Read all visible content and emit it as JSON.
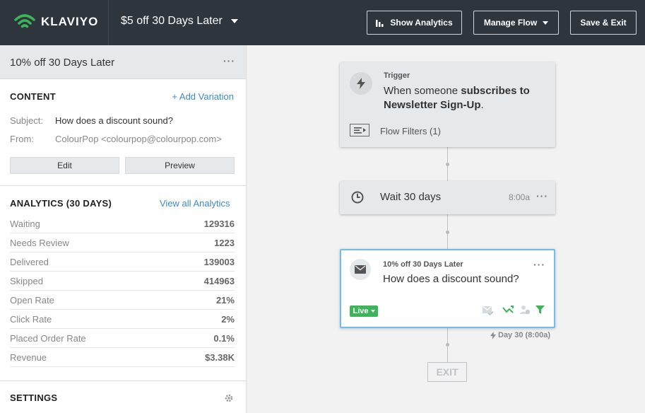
{
  "header": {
    "brand": "KLAVIYO",
    "flow_name": "$5 off 30 Days Later",
    "show_analytics": "Show Analytics",
    "manage_flow": "Manage Flow",
    "save_exit": "Save & Exit"
  },
  "sidebar": {
    "title": "10% off 30 Days Later",
    "more": "···",
    "content": {
      "heading": "CONTENT",
      "add_variation": "+ Add Variation",
      "subject_label": "Subject:",
      "subject_value": "How does a discount sound?",
      "from_label": "From:",
      "from_value": "ColourPop <colourpop@colourpop.com>",
      "edit": "Edit",
      "preview": "Preview"
    },
    "analytics": {
      "heading": "ANALYTICS (30 DAYS)",
      "view_all": "View all Analytics",
      "rows": [
        {
          "label": "Waiting",
          "value": "129316"
        },
        {
          "label": "Needs Review",
          "value": "1223"
        },
        {
          "label": "Delivered",
          "value": "139003"
        },
        {
          "label": "Skipped",
          "value": "414963"
        },
        {
          "label": "Open Rate",
          "value": "21%"
        },
        {
          "label": "Click Rate",
          "value": "2%"
        },
        {
          "label": "Placed Order Rate",
          "value": "0.1%"
        },
        {
          "label": "Revenue",
          "value": "$3.38K"
        }
      ]
    },
    "settings": {
      "heading": "SETTINGS"
    }
  },
  "canvas": {
    "trigger": {
      "label": "Trigger",
      "text_pre": "When someone ",
      "text_bold1": "subscribes to",
      "text_bold2": "Newsletter Sign-Up",
      "text_post": ".",
      "filters": "Flow Filters (1)"
    },
    "wait": {
      "label": "Wait 30 days",
      "time": "8:00a",
      "more": "···"
    },
    "email": {
      "name": "10% off 30 Days Later",
      "subject": "How does a discount sound?",
      "status": "Live",
      "more": "···"
    },
    "schedule": "Day 30 (8:00a)",
    "exit": "EXIT"
  },
  "colors": {
    "topbar": "#2f353d",
    "brand_green": "#3cb55a",
    "link_blue": "#3a8ad0",
    "selected_border": "#6ec0e8"
  }
}
